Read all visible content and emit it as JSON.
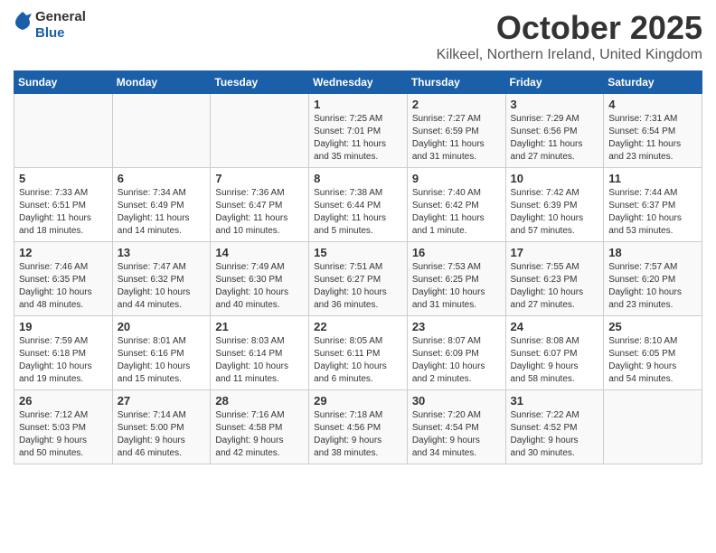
{
  "header": {
    "logo_general": "General",
    "logo_blue": "Blue",
    "month_title": "October 2025",
    "location": "Kilkeel, Northern Ireland, United Kingdom"
  },
  "weekdays": [
    "Sunday",
    "Monday",
    "Tuesday",
    "Wednesday",
    "Thursday",
    "Friday",
    "Saturday"
  ],
  "weeks": [
    [
      {
        "day": "",
        "info": ""
      },
      {
        "day": "",
        "info": ""
      },
      {
        "day": "",
        "info": ""
      },
      {
        "day": "1",
        "info": "Sunrise: 7:25 AM\nSunset: 7:01 PM\nDaylight: 11 hours\nand 35 minutes."
      },
      {
        "day": "2",
        "info": "Sunrise: 7:27 AM\nSunset: 6:59 PM\nDaylight: 11 hours\nand 31 minutes."
      },
      {
        "day": "3",
        "info": "Sunrise: 7:29 AM\nSunset: 6:56 PM\nDaylight: 11 hours\nand 27 minutes."
      },
      {
        "day": "4",
        "info": "Sunrise: 7:31 AM\nSunset: 6:54 PM\nDaylight: 11 hours\nand 23 minutes."
      }
    ],
    [
      {
        "day": "5",
        "info": "Sunrise: 7:33 AM\nSunset: 6:51 PM\nDaylight: 11 hours\nand 18 minutes."
      },
      {
        "day": "6",
        "info": "Sunrise: 7:34 AM\nSunset: 6:49 PM\nDaylight: 11 hours\nand 14 minutes."
      },
      {
        "day": "7",
        "info": "Sunrise: 7:36 AM\nSunset: 6:47 PM\nDaylight: 11 hours\nand 10 minutes."
      },
      {
        "day": "8",
        "info": "Sunrise: 7:38 AM\nSunset: 6:44 PM\nDaylight: 11 hours\nand 5 minutes."
      },
      {
        "day": "9",
        "info": "Sunrise: 7:40 AM\nSunset: 6:42 PM\nDaylight: 11 hours\nand 1 minute."
      },
      {
        "day": "10",
        "info": "Sunrise: 7:42 AM\nSunset: 6:39 PM\nDaylight: 10 hours\nand 57 minutes."
      },
      {
        "day": "11",
        "info": "Sunrise: 7:44 AM\nSunset: 6:37 PM\nDaylight: 10 hours\nand 53 minutes."
      }
    ],
    [
      {
        "day": "12",
        "info": "Sunrise: 7:46 AM\nSunset: 6:35 PM\nDaylight: 10 hours\nand 48 minutes."
      },
      {
        "day": "13",
        "info": "Sunrise: 7:47 AM\nSunset: 6:32 PM\nDaylight: 10 hours\nand 44 minutes."
      },
      {
        "day": "14",
        "info": "Sunrise: 7:49 AM\nSunset: 6:30 PM\nDaylight: 10 hours\nand 40 minutes."
      },
      {
        "day": "15",
        "info": "Sunrise: 7:51 AM\nSunset: 6:27 PM\nDaylight: 10 hours\nand 36 minutes."
      },
      {
        "day": "16",
        "info": "Sunrise: 7:53 AM\nSunset: 6:25 PM\nDaylight: 10 hours\nand 31 minutes."
      },
      {
        "day": "17",
        "info": "Sunrise: 7:55 AM\nSunset: 6:23 PM\nDaylight: 10 hours\nand 27 minutes."
      },
      {
        "day": "18",
        "info": "Sunrise: 7:57 AM\nSunset: 6:20 PM\nDaylight: 10 hours\nand 23 minutes."
      }
    ],
    [
      {
        "day": "19",
        "info": "Sunrise: 7:59 AM\nSunset: 6:18 PM\nDaylight: 10 hours\nand 19 minutes."
      },
      {
        "day": "20",
        "info": "Sunrise: 8:01 AM\nSunset: 6:16 PM\nDaylight: 10 hours\nand 15 minutes."
      },
      {
        "day": "21",
        "info": "Sunrise: 8:03 AM\nSunset: 6:14 PM\nDaylight: 10 hours\nand 11 minutes."
      },
      {
        "day": "22",
        "info": "Sunrise: 8:05 AM\nSunset: 6:11 PM\nDaylight: 10 hours\nand 6 minutes."
      },
      {
        "day": "23",
        "info": "Sunrise: 8:07 AM\nSunset: 6:09 PM\nDaylight: 10 hours\nand 2 minutes."
      },
      {
        "day": "24",
        "info": "Sunrise: 8:08 AM\nSunset: 6:07 PM\nDaylight: 9 hours\nand 58 minutes."
      },
      {
        "day": "25",
        "info": "Sunrise: 8:10 AM\nSunset: 6:05 PM\nDaylight: 9 hours\nand 54 minutes."
      }
    ],
    [
      {
        "day": "26",
        "info": "Sunrise: 7:12 AM\nSunset: 5:03 PM\nDaylight: 9 hours\nand 50 minutes."
      },
      {
        "day": "27",
        "info": "Sunrise: 7:14 AM\nSunset: 5:00 PM\nDaylight: 9 hours\nand 46 minutes."
      },
      {
        "day": "28",
        "info": "Sunrise: 7:16 AM\nSunset: 4:58 PM\nDaylight: 9 hours\nand 42 minutes."
      },
      {
        "day": "29",
        "info": "Sunrise: 7:18 AM\nSunset: 4:56 PM\nDaylight: 9 hours\nand 38 minutes."
      },
      {
        "day": "30",
        "info": "Sunrise: 7:20 AM\nSunset: 4:54 PM\nDaylight: 9 hours\nand 34 minutes."
      },
      {
        "day": "31",
        "info": "Sunrise: 7:22 AM\nSunset: 4:52 PM\nDaylight: 9 hours\nand 30 minutes."
      },
      {
        "day": "",
        "info": ""
      }
    ]
  ]
}
